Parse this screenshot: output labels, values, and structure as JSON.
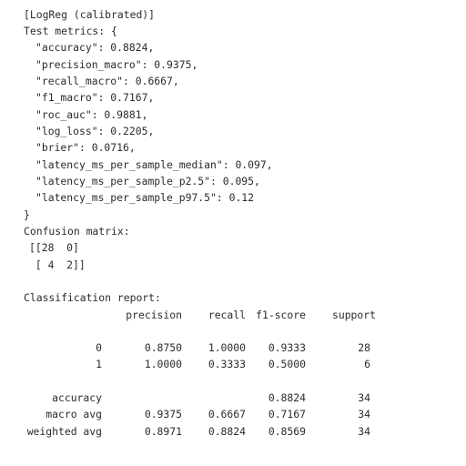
{
  "output": {
    "header": "[LogReg (calibrated)]",
    "metrics_open": "Test metrics: {",
    "metrics": [
      "\"accuracy\": 0.8824,",
      "\"precision_macro\": 0.9375,",
      "\"recall_macro\": 0.6667,",
      "\"f1_macro\": 0.7167,",
      "\"roc_auc\": 0.9881,",
      "\"log_loss\": 0.2205,",
      "\"brier\": 0.0716,",
      "\"latency_ms_per_sample_median\": 0.097,",
      "\"latency_ms_per_sample_p2.5\": 0.095,",
      "\"latency_ms_per_sample_p97.5\": 0.12"
    ],
    "metrics_close": "}",
    "confusion_title": "Confusion matrix:",
    "confusion_rows": [
      "[[28  0]",
      " [ 4  2]]"
    ],
    "report_title": "Classification report:",
    "report_headers": [
      "precision",
      "recall",
      "f1-score",
      "support"
    ],
    "report_rows": [
      {
        "label": "0",
        "precision": "0.8750",
        "recall": "1.0000",
        "f1": "0.9333",
        "support": "28"
      },
      {
        "label": "1",
        "precision": "1.0000",
        "recall": "0.3333",
        "f1": "0.5000",
        "support": "6"
      }
    ],
    "report_summary": [
      {
        "label": "accuracy",
        "precision": "",
        "recall": "",
        "f1": "0.8824",
        "support": "34"
      },
      {
        "label": "macro avg",
        "precision": "0.9375",
        "recall": "0.6667",
        "f1": "0.7167",
        "support": "34"
      },
      {
        "label": "weighted avg",
        "precision": "0.8971",
        "recall": "0.8824",
        "f1": "0.8569",
        "support": "34"
      }
    ]
  }
}
